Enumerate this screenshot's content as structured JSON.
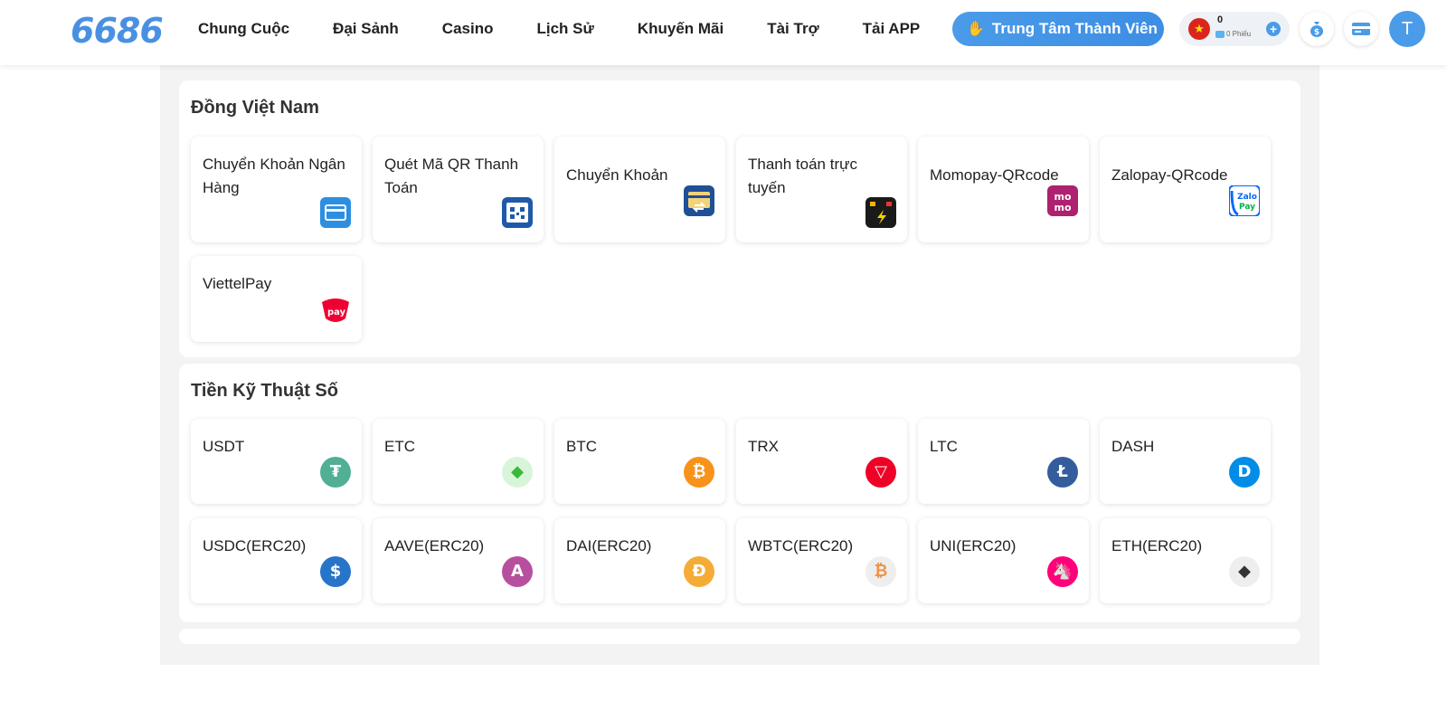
{
  "header": {
    "logo": "6686",
    "nav": [
      "Chung Cuộc",
      "Đại Sảnh",
      "Casino",
      "Lịch Sử",
      "Khuyến Mãi",
      "Tài Trợ",
      "Tải APP"
    ],
    "member_button": "Trung Tâm Thành Viên",
    "balance": "0",
    "tickets": "0 Phiếu",
    "avatar_letter": "T"
  },
  "vnd": {
    "title": "Đồng Việt Nam",
    "items": [
      {
        "label": "Chuyển Khoản Ngân Hàng",
        "icon": "bank-card-icon"
      },
      {
        "label": "Quét Mã QR Thanh Toán",
        "icon": "qr-code-icon"
      },
      {
        "label": "Chuyển Khoản",
        "icon": "transfer-card-icon"
      },
      {
        "label": "Thanh toán trực tuyến",
        "icon": "online-payment-icon"
      },
      {
        "label": "Momopay-QRcode",
        "icon": "momo-icon"
      },
      {
        "label": "Zalopay-QRcode",
        "icon": "zalopay-icon"
      },
      {
        "label": "ViettelPay",
        "icon": "viettelpay-icon"
      }
    ]
  },
  "crypto": {
    "title": "Tiền Kỹ Thuật Số",
    "items": [
      {
        "label": "USDT",
        "icon": "usdt-icon",
        "color": "#50af95"
      },
      {
        "label": "ETC",
        "icon": "etc-icon",
        "color": "#3ab83a"
      },
      {
        "label": "BTC",
        "icon": "btc-icon",
        "color": "#f7931a"
      },
      {
        "label": "TRX",
        "icon": "trx-icon",
        "color": "#ef0027"
      },
      {
        "label": "LTC",
        "icon": "ltc-icon",
        "color": "#345d9d"
      },
      {
        "label": "DASH",
        "icon": "dash-icon",
        "color": "#008ce7"
      },
      {
        "label": "USDC(ERC20)",
        "icon": "usdc-icon",
        "color": "#2775ca"
      },
      {
        "label": "AAVE(ERC20)",
        "icon": "aave-icon",
        "color": "#b6509e"
      },
      {
        "label": "DAI(ERC20)",
        "icon": "dai-icon",
        "color": "#f5ac37"
      },
      {
        "label": "WBTC(ERC20)",
        "icon": "wbtc-icon",
        "color": "#f09242"
      },
      {
        "label": "UNI(ERC20)",
        "icon": "uni-icon",
        "color": "#ff007a"
      },
      {
        "label": "ETH(ERC20)",
        "icon": "eth-icon",
        "color": "#343434"
      }
    ]
  }
}
